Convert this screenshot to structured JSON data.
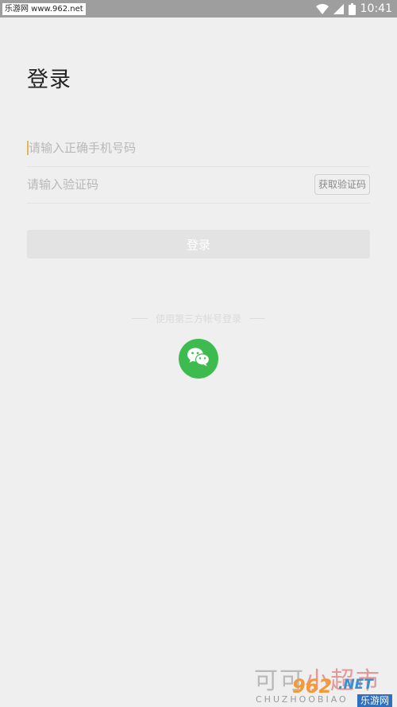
{
  "status_bar": {
    "watermark_text": "乐游网 www.962.net",
    "time": "10:41",
    "icons": [
      "wifi-icon",
      "signal-icon",
      "battery-icon"
    ]
  },
  "page": {
    "title": "登录"
  },
  "form": {
    "phone_placeholder": "请输入正确手机号码",
    "code_placeholder": "请输入验证码",
    "get_code_label": "获取验证码",
    "login_label": "登录"
  },
  "third_party": {
    "label": "使用第三方帐号登录",
    "wechat_icon": "wechat-icon",
    "wechat_color": "#3ebb4f"
  },
  "watermark": {
    "big_text_gray": "可可",
    "big_text_red": "小超市",
    "small_text": "CHUZHOOBIAO",
    "site_number": "962",
    "site_suffix": ".NET",
    "site_name": "乐游网"
  },
  "colors": {
    "background": "#efefef",
    "status_bar": "#9e9e9e",
    "accent_caret": "#e0b85a",
    "button_disabled": "#e3e3e3"
  }
}
